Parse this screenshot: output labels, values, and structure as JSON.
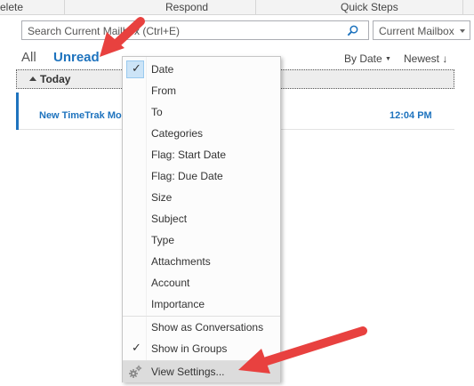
{
  "ribbon": {
    "delete_label": "elete",
    "respond_label": "Respond",
    "quick_steps_label": "Quick Steps"
  },
  "search": {
    "placeholder": "Search Current Mailbox (Ctrl+E)",
    "scope": "Current Mailbox"
  },
  "filters": {
    "all": "All",
    "unread": "Unread",
    "sort_by": "By Date",
    "sort_order": "Newest"
  },
  "group": {
    "label": "Today"
  },
  "message": {
    "subject": "New TimeTrak Mo",
    "time": "12:04 PM"
  },
  "menu": {
    "arrange_items": [
      {
        "label": "Date",
        "checked": true
      },
      {
        "label": "From",
        "checked": false
      },
      {
        "label": "To",
        "checked": false
      },
      {
        "label": "Categories",
        "checked": false
      },
      {
        "label": "Flag: Start Date",
        "checked": false
      },
      {
        "label": "Flag: Due Date",
        "checked": false
      },
      {
        "label": "Size",
        "checked": false
      },
      {
        "label": "Subject",
        "checked": false
      },
      {
        "label": "Type",
        "checked": false
      },
      {
        "label": "Attachments",
        "checked": false
      },
      {
        "label": "Account",
        "checked": false
      },
      {
        "label": "Importance",
        "checked": false
      }
    ],
    "view_items": [
      {
        "label": "Show as Conversations",
        "checked": false
      },
      {
        "label": "Show in Groups",
        "checked": true
      }
    ],
    "settings_label": "View Settings..."
  },
  "colors": {
    "accent": "#1e73be",
    "annotation_arrow": "#e8413f"
  }
}
